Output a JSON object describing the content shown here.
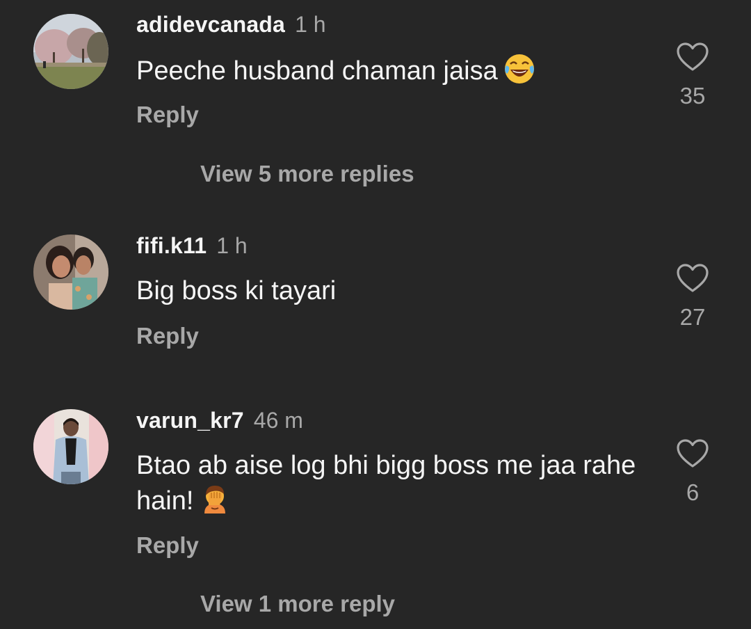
{
  "comments": [
    {
      "username": "adidevcanada",
      "time": "1 h",
      "text": "Peeche husband chaman jaisa",
      "emoji": "tears-of-joy-emoji",
      "reply_label": "Reply",
      "likes": "35",
      "view_replies": "View 5 more replies"
    },
    {
      "username": "fifi.k11",
      "time": "1 h",
      "text": "Big boss ki tayari",
      "reply_label": "Reply",
      "likes": "27"
    },
    {
      "username": "varun_kr7",
      "time": "46 m",
      "text": "Btao ab aise log bhi bigg boss me jaa rahe hain!",
      "emoji": "facepalm-emoji",
      "reply_label": "Reply",
      "likes": "6",
      "view_replies": "View 1 more reply"
    }
  ],
  "icons": {
    "like": "heart-outline-icon"
  },
  "colors": {
    "background": "#262626",
    "primary_text": "#f5f5f5",
    "secondary_text": "#a8a8a8"
  }
}
